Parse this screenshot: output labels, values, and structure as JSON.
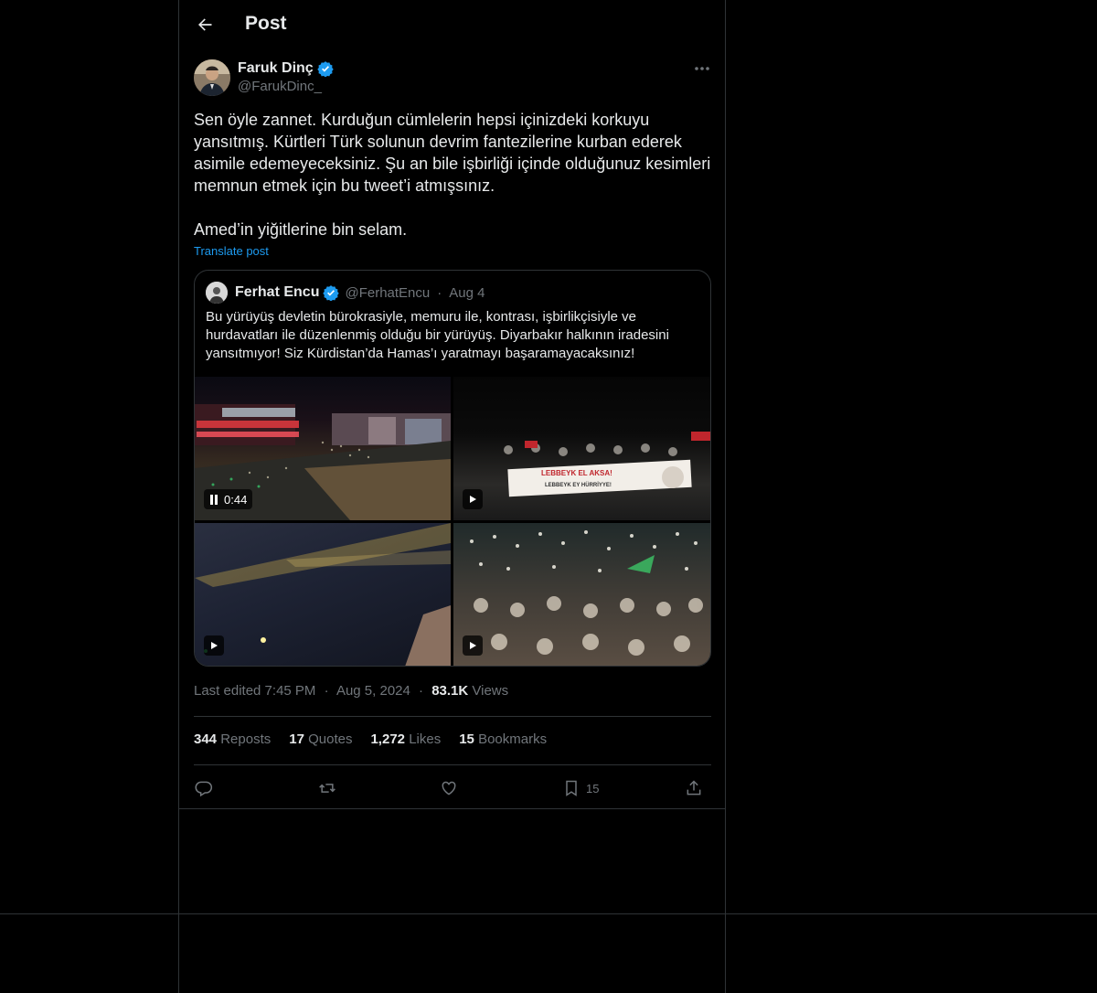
{
  "header": {
    "title": "Post"
  },
  "post": {
    "author_name": "Faruk Dinç",
    "author_handle": "@FarukDinc_",
    "text": "Sen öyle zannet. Kurduğun cümlelerin hepsi içinizdeki korkuyu yansıtmış. Kürtleri Türk solunun devrim fantezilerine kurban ederek asimile edemeyeceksiniz. Şu an bile işbirliği içinde olduğunuz kesimleri memnun etmek için bu tweet’i atmışsınız.\n\nAmed’in yiğitlerine bin selam.",
    "translate_label": "Translate post",
    "quote": {
      "author_name": "Ferhat Encu",
      "author_handle": "@FerhatEncu",
      "separator": "·",
      "date": "Aug 4",
      "text": "Bu yürüyüş devletin bürokrasiyle, memuru ile, kontrası, işbirlikçisiyle ve hurdavatları ile düzenlenmiş olduğu bir yürüyüş. Diyarbakır halkının iradesini yansıtmıyor! Siz Kürdistan’da Hamas’ı yaratmayı başaramayacaksınız!",
      "media": [
        {
          "type": "video",
          "duration": "0:44",
          "state": "playing"
        },
        {
          "type": "video",
          "banner_line1": "LEBBEYK EL AKSA!",
          "banner_line2": "LEBBEYK EY HÜRRİYYE!"
        },
        {
          "type": "video"
        },
        {
          "type": "video"
        }
      ]
    },
    "meta": {
      "edited": "Last edited 7:45 PM",
      "dot": "·",
      "date": "Aug 5, 2024",
      "views_count": "83.1K",
      "views_label": "Views"
    },
    "stats": {
      "reposts_count": "344",
      "reposts_label": "Reposts",
      "quotes_count": "17",
      "quotes_label": "Quotes",
      "likes_count": "1,272",
      "likes_label": "Likes",
      "bookmarks_count": "15",
      "bookmarks_label": "Bookmarks"
    },
    "actions": {
      "bookmark_count": "15"
    }
  },
  "colors": {
    "background": "#000000",
    "text": "#e7e9ea",
    "muted": "#71767b",
    "accent": "#1d9bf0",
    "border": "#2f3336"
  },
  "icons": [
    "back-arrow-icon",
    "verified-badge-icon",
    "more-icon",
    "pause-icon",
    "play-icon",
    "reply-icon",
    "repost-icon",
    "like-icon",
    "bookmark-icon",
    "share-icon"
  ]
}
